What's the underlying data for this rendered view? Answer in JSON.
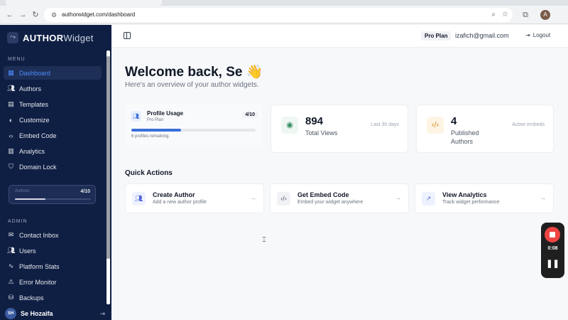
{
  "browser": {
    "url": "authorwidget.com/dashboard",
    "profile_initial": "A"
  },
  "sidebar": {
    "brand_bold": "AUTHOR",
    "brand_light": "Widget",
    "menu_label": "MENU",
    "menu_items": [
      {
        "label": "Dashboard",
        "icon": "grid-icon",
        "active": true
      },
      {
        "label": "Authors",
        "icon": "users-icon"
      },
      {
        "label": "Templates",
        "icon": "file-icon"
      },
      {
        "label": "Customize",
        "icon": "palette-icon"
      },
      {
        "label": "Embed Code",
        "icon": "code-icon"
      },
      {
        "label": "Analytics",
        "icon": "bar-chart-icon"
      },
      {
        "label": "Domain Lock",
        "icon": "shield-icon"
      }
    ],
    "usage": {
      "label": "Authors",
      "count": "4/10",
      "fill_fraction": 0.4
    },
    "admin_label": "ADMIN",
    "admin_items": [
      {
        "label": "Contact Inbox",
        "icon": "mail-icon"
      },
      {
        "label": "Users",
        "icon": "users-icon"
      },
      {
        "label": "Platform Stats",
        "icon": "activity-icon"
      },
      {
        "label": "Error Monitor",
        "icon": "alert-icon"
      },
      {
        "label": "Backups",
        "icon": "database-icon"
      }
    ],
    "user": {
      "initials": "SH",
      "name": "Se Hozaifa"
    }
  },
  "header": {
    "plan": "Pro Plan",
    "email": "izafich@gmail.com",
    "logout": "Logout"
  },
  "main": {
    "welcome": "Welcome back, Se 👋",
    "subtitle": "Here's an overview of your author widgets.",
    "profile_usage": {
      "title": "Profile Usage",
      "plan": "Pro Plan",
      "count": "4/10",
      "fill_fraction": 0.4,
      "remaining": "6 profiles remaining."
    },
    "stats": [
      {
        "value": "894",
        "label": "Total Views",
        "note": "Last 30 days",
        "icon": "eye-icon"
      },
      {
        "value": "4",
        "label": "Published Authors",
        "note": "Active embeds",
        "icon": "code-icon"
      }
    ],
    "quick_actions_title": "Quick Actions",
    "quick_actions": [
      {
        "label": "Create Author",
        "desc": "Add a new author profile",
        "icon": "users-icon"
      },
      {
        "label": "Get Embed Code",
        "desc": "Embed your widget anywhere",
        "icon": "code-icon"
      },
      {
        "label": "View Analytics",
        "desc": "Track widget performance",
        "icon": "trend-icon"
      }
    ]
  },
  "recorder": {
    "time": "0:08"
  }
}
